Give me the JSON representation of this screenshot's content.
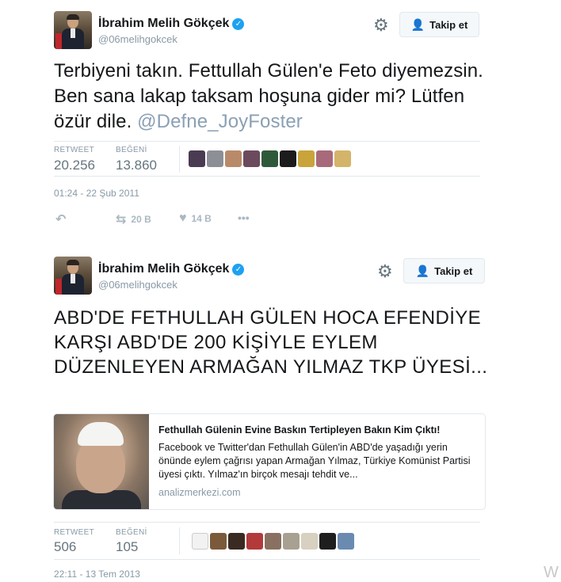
{
  "tweet1": {
    "author_name": "İbrahim Melih Gökçek",
    "handle": "@06melihgokcek",
    "follow_label": "Takip et",
    "text": "Terbiyeni takın. Fettullah Gülen'e Feto diyemezsin. Ben sana lakap taksam hoşuna gider mi? Lütfen özür dile.",
    "mention": "@Defne_JoyFoster",
    "retweet_label": "RETWEET",
    "retweet_count": "20.256",
    "like_label": "BEĞENİ",
    "like_count": "13.860",
    "timestamp": "01:24 - 22 Şub 2011",
    "action_retweets": "20 B",
    "action_likes": "14 B",
    "more": "•••"
  },
  "tweet2": {
    "author_name": "İbrahim Melih Gökçek",
    "handle": "@06melihgokcek",
    "follow_label": "Takip et",
    "text": "ABD'DE FETHULLAH GÜLEN HOCA EFENDİYE KARŞI ABD'DE 200 KİŞİYLE EYLEM DÜZENLEYEN ARMAĞAN YILMAZ TKP ÜYESİ...",
    "card": {
      "title": "Fethullah Gülenin Evine Baskın Tertipleyen Bakın Kim Çıktı!",
      "description": "Facebook ve Twitter'dan Fethullah Gülen'in ABD'de yaşadığı yerin önünde eylem çağrısı yapan Armağan Yılmaz, Türkiye Komünist Partisi üyesi çıktı. Yılmaz'ın birçok mesajı tehdit ve...",
      "domain": "analizmerkezi.com"
    },
    "retweet_label": "RETWEET",
    "retweet_count": "506",
    "like_label": "BEĞENİ",
    "like_count": "105",
    "timestamp": "22:11 - 13 Tem 2013"
  },
  "icons": {
    "verified": "verified-badge-icon",
    "gear": "gear-icon",
    "follow": "add-user-icon",
    "reply": "reply-icon",
    "retweet": "retweet-icon",
    "like": "heart-icon",
    "more": "more-icon"
  },
  "colors": {
    "accent": "#1da1f2",
    "text": "#14171a",
    "muted": "#8899a6",
    "mention": "#8aa0b4"
  },
  "watermark": "W"
}
